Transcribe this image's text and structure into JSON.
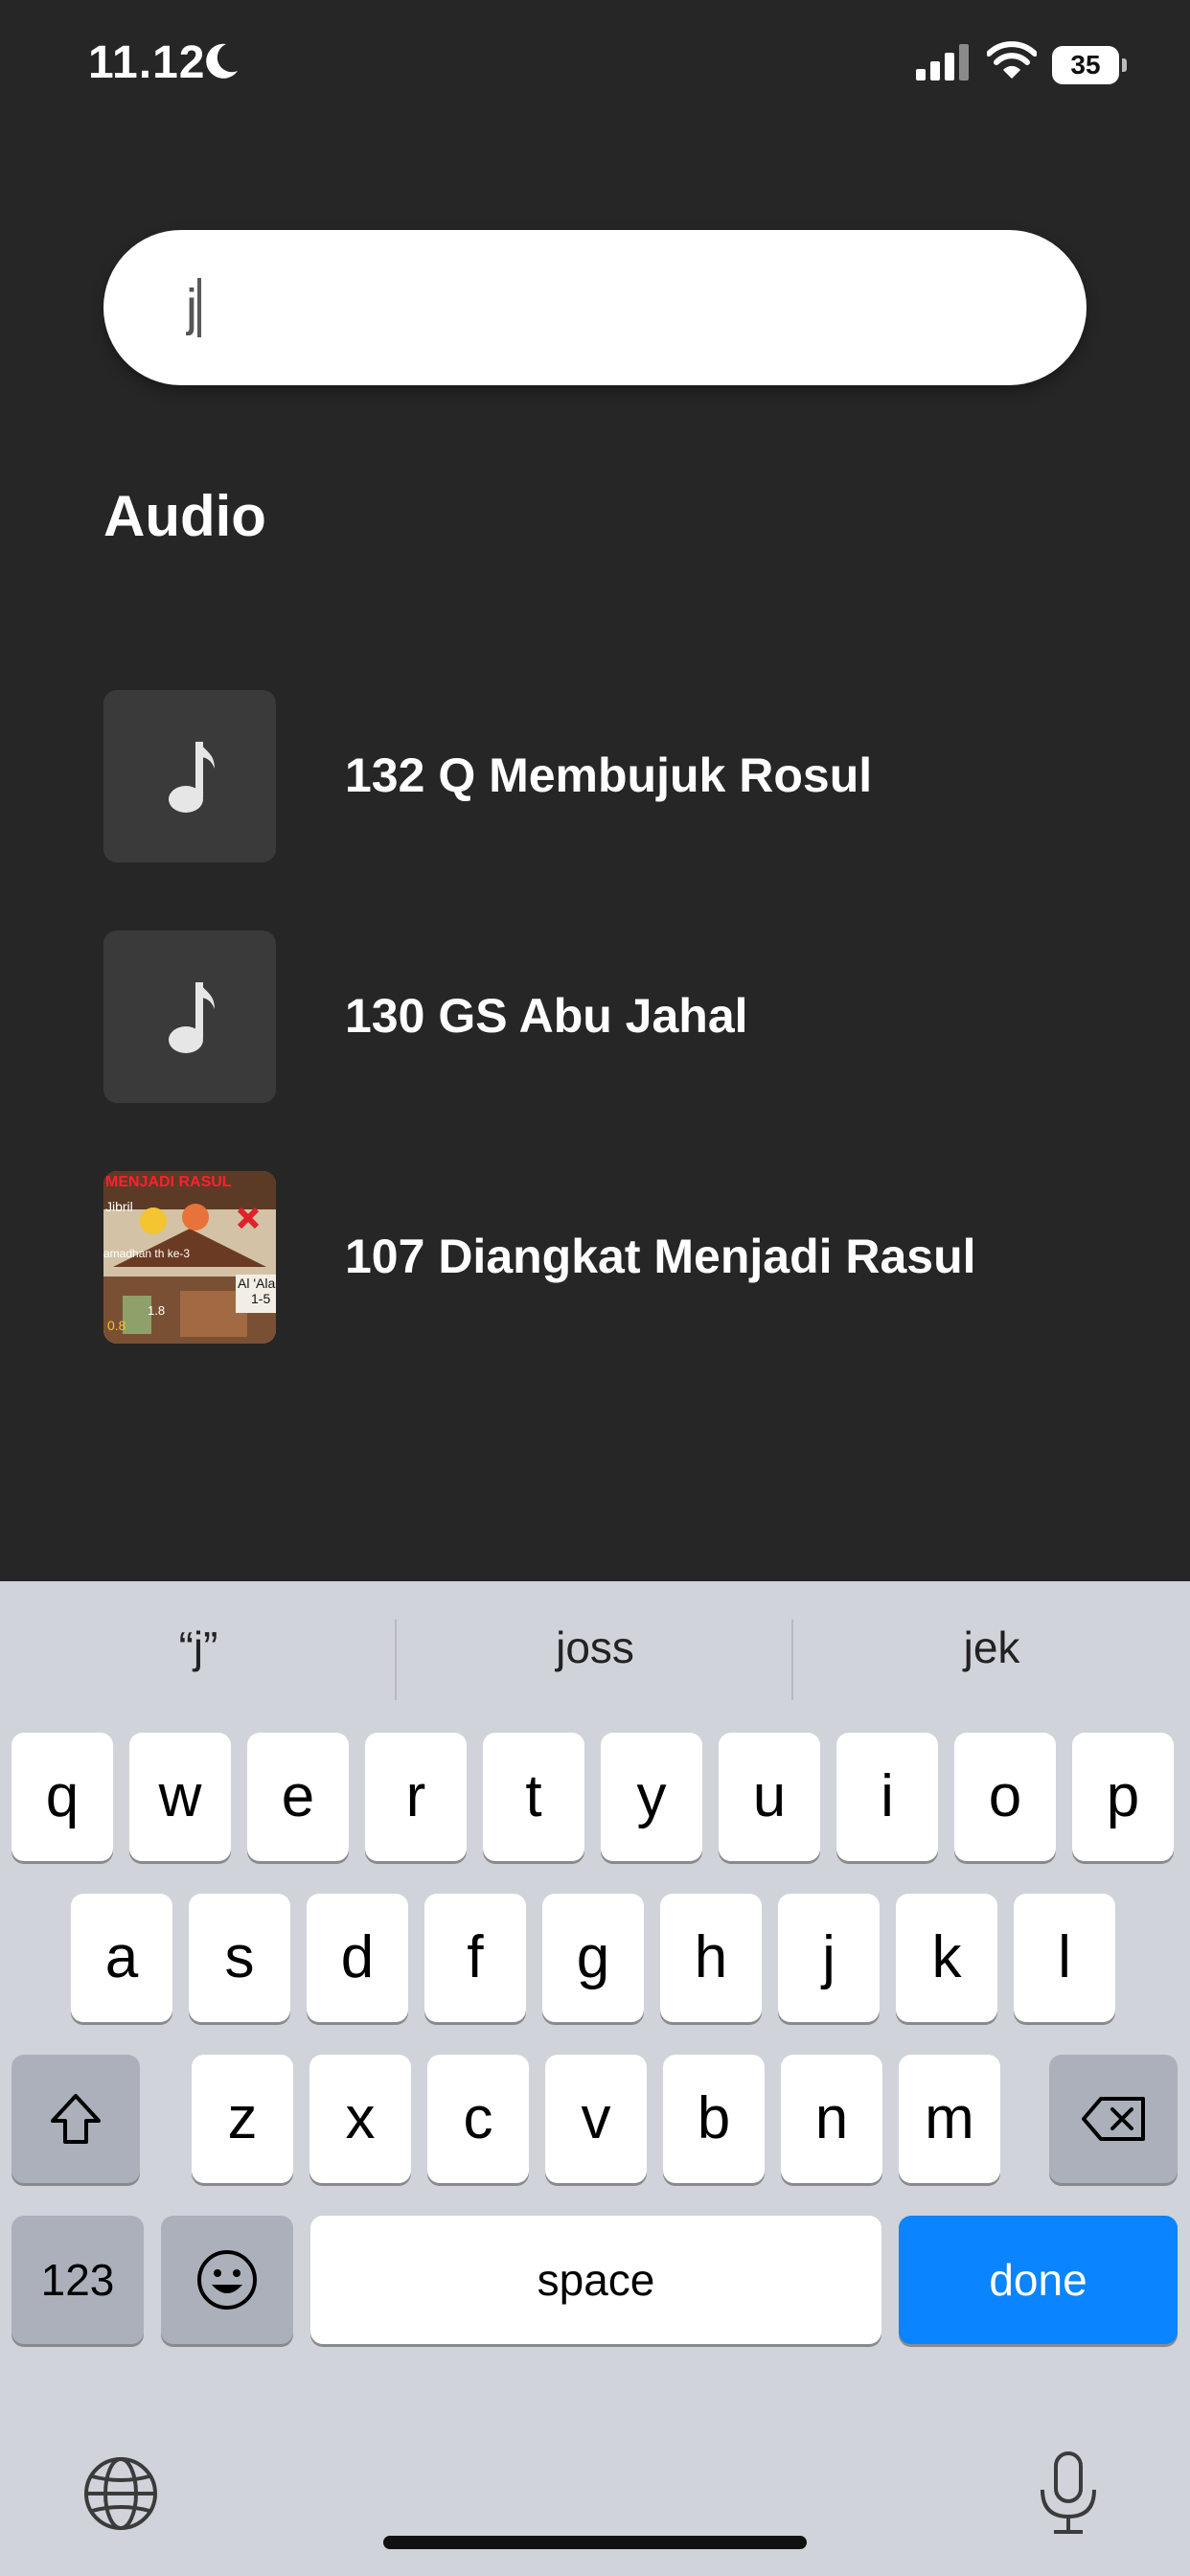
{
  "status_bar": {
    "time": "11.12",
    "battery": "35"
  },
  "search": {
    "value": "j"
  },
  "section": {
    "title": "Audio"
  },
  "results": [
    {
      "title": "132 Q Membujuk Rosul",
      "thumb": "music-note-icon"
    },
    {
      "title": "130 GS Abu Jahal",
      "thumb": "music-note-icon"
    },
    {
      "title": "107 Diangkat Menjadi Rasul",
      "thumb": "video-thumbnail",
      "thumb_text": {
        "header": "MENJADI RASUL",
        "a": "Jibril",
        "b": "amadhan th ke-3",
        "c": "Al 'Ala",
        "d": "1-5",
        "e": "1.8",
        "f": "0.8"
      }
    }
  ],
  "keyboard": {
    "suggestions": [
      "“j”",
      "joss",
      "jek"
    ],
    "row1": [
      "q",
      "w",
      "e",
      "r",
      "t",
      "y",
      "u",
      "i",
      "o",
      "p"
    ],
    "row2": [
      "a",
      "s",
      "d",
      "f",
      "g",
      "h",
      "j",
      "k",
      "l"
    ],
    "row3": [
      "z",
      "x",
      "c",
      "v",
      "b",
      "n",
      "m"
    ],
    "numbers_label": "123",
    "space_label": "space",
    "done_label": "done"
  },
  "colors": {
    "background": "#262626",
    "keyboard": "#d0d3d9",
    "done": "#0a84ff"
  }
}
